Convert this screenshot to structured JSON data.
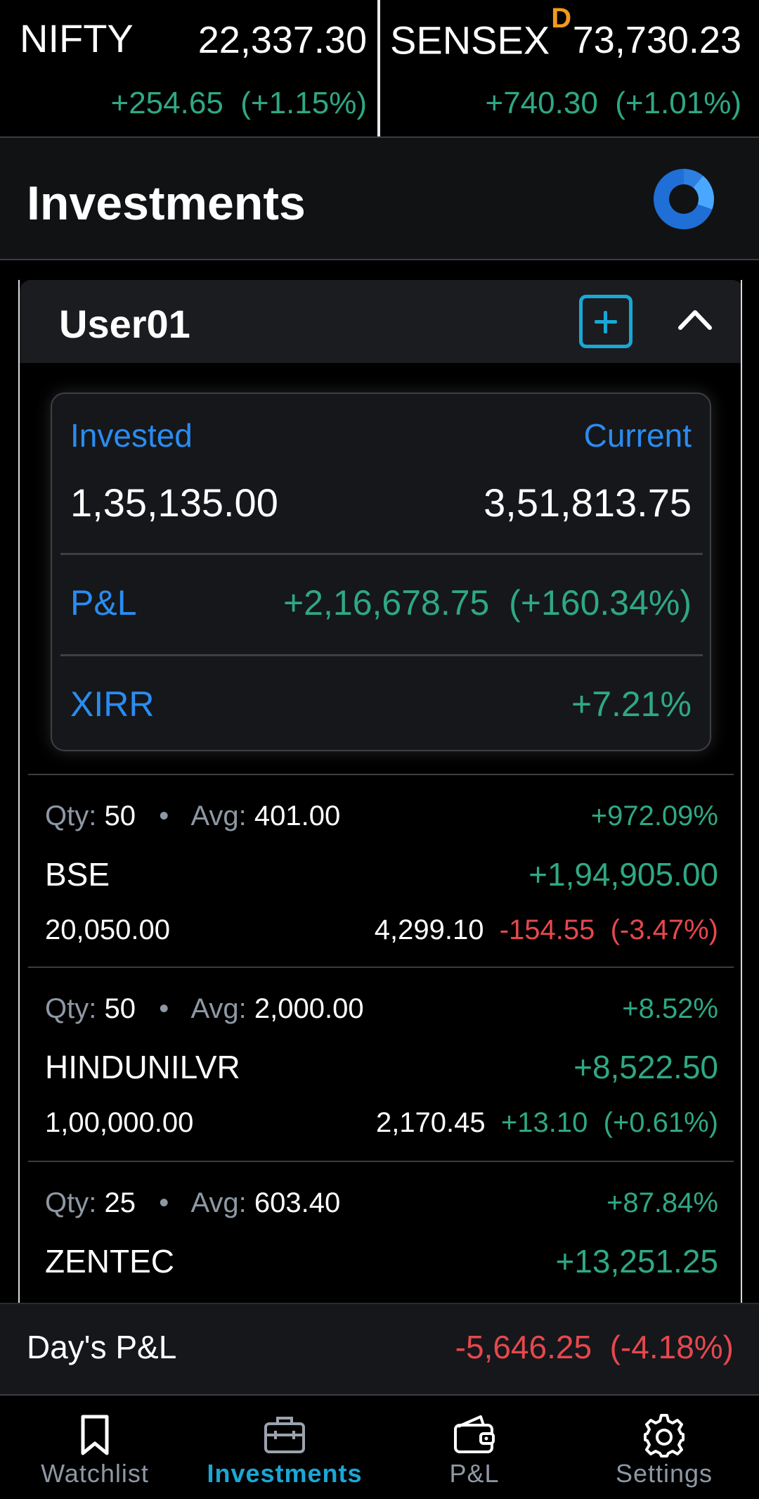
{
  "ticker": {
    "nifty": {
      "name": "NIFTY",
      "price": "22,337.30",
      "change": "+254.65  (+1.15%)"
    },
    "sensex": {
      "name": "SENSEX",
      "badge": "D",
      "price": "73,730.23",
      "change": "+740.30  (+1.01%)"
    }
  },
  "header": {
    "title": "Investments"
  },
  "user": {
    "name": "User01",
    "summary": {
      "invested_label": "Invested",
      "current_label": "Current",
      "invested_value": "1,35,135.00",
      "current_value": "3,51,813.75",
      "pnl_label": "P&L",
      "pnl_value": "+2,16,678.75  (+160.34%)",
      "xirr_label": "XIRR",
      "xirr_value": "+7.21%"
    },
    "holdings": [
      {
        "qty_label": "Qty:",
        "qty": "50",
        "avg_label": "Avg:",
        "avg": "401.00",
        "return_pct": "+972.09%",
        "symbol": "BSE",
        "pnl": "+1,94,905.00",
        "invested": "20,050.00",
        "ltp": "4,299.10",
        "day_change": "-154.55  (-3.47%)",
        "day_direction": "down"
      },
      {
        "qty_label": "Qty:",
        "qty": "50",
        "avg_label": "Avg:",
        "avg": "2,000.00",
        "return_pct": "+8.52%",
        "symbol": "HINDUNILVR",
        "pnl": "+8,522.50",
        "invested": "1,00,000.00",
        "ltp": "2,170.45",
        "day_change": "+13.10  (+0.61%)",
        "day_direction": "up"
      },
      {
        "qty_label": "Qty:",
        "qty": "25",
        "avg_label": "Avg:",
        "avg": "603.40",
        "return_pct": "+87.84%",
        "symbol": "ZENTEC",
        "pnl": "+13,251.25"
      }
    ]
  },
  "day_pnl": {
    "label": "Day's P&L",
    "value": "-5,646.25  (-4.18%)"
  },
  "nav": [
    {
      "label": "Watchlist",
      "icon": "bookmark-icon"
    },
    {
      "label": "Investments",
      "icon": "briefcase-icon",
      "active": true
    },
    {
      "label": "P&L",
      "icon": "wallet-icon"
    },
    {
      "label": "Settings",
      "icon": "gear-icon"
    }
  ],
  "colors": {
    "positive": "#2fa884",
    "negative": "#e5484d",
    "accent": "#1aa7d6",
    "label_blue": "#2a8cf0"
  }
}
